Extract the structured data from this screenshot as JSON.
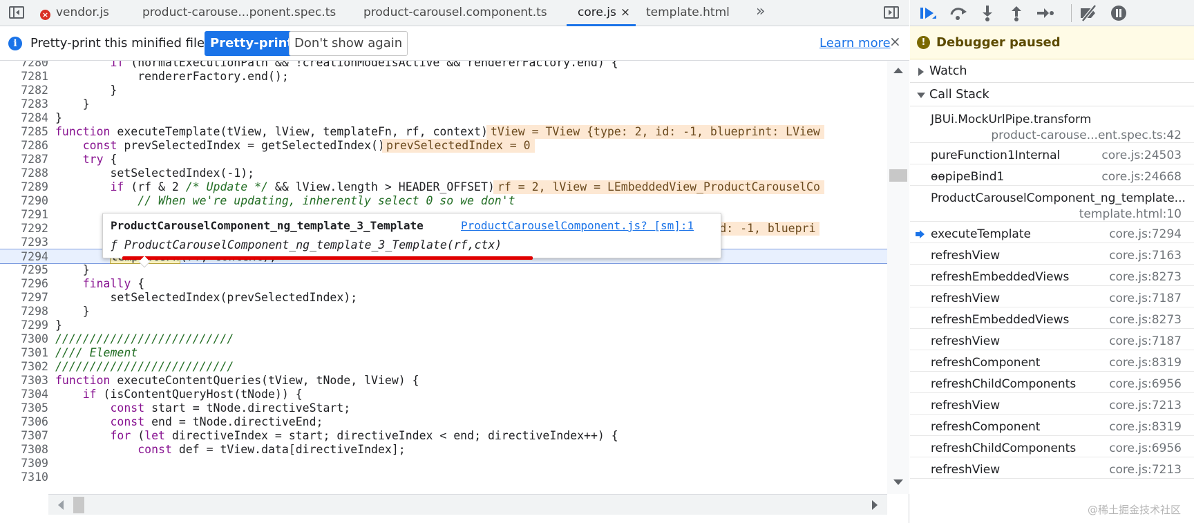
{
  "tabs": [
    {
      "label": "vendor.js",
      "has_error": true,
      "active": false
    },
    {
      "label": "product-carouse...ponent.spec.ts",
      "active": false
    },
    {
      "label": "product-carousel.component.ts",
      "active": false
    },
    {
      "label": "core.js",
      "active": true,
      "close": "×"
    },
    {
      "label": "template.html",
      "active": false
    }
  ],
  "tabs_more": "»",
  "infobar": {
    "icon": "i",
    "message": "Pretty-print this minified file?",
    "pretty_print_label": "Pretty-print",
    "dont_show_label": "Don't show again",
    "learn_more_label": "Learn more",
    "close": "×"
  },
  "code_lines": [
    {
      "n": "7280",
      "text": "        if (normalExecutionPath && !creationModeIsActive && rendererFactory.end) {"
    },
    {
      "n": "7281",
      "text": "            rendererFactory.end();"
    },
    {
      "n": "7282",
      "text": "        }"
    },
    {
      "n": "7283",
      "text": "    }"
    },
    {
      "n": "7284",
      "text": "}"
    },
    {
      "n": "7285",
      "text": "function executeTemplate(tView, lView, templateFn, rf, context) {",
      "inline": "tView = TView {type: 2, id: -1, blueprint: LView"
    },
    {
      "n": "7286",
      "text": "    const prevSelectedIndex = getSelectedIndex();",
      "inline": "prevSelectedIndex = 0"
    },
    {
      "n": "7287",
      "text": "    try {"
    },
    {
      "n": "7288",
      "text": "        setSelectedIndex(-1);"
    },
    {
      "n": "7289",
      "text": "        if (rf & 2 /* Update */ && lView.length > HEADER_OFFSET) {",
      "inline": "rf = 2, lView = LEmbeddedView_ProductCarouselCo"
    },
    {
      "n": "7290",
      "text": "            // When we're updating, inherently select 0 so we don't"
    },
    {
      "n": "7291",
      "text": ""
    },
    {
      "n": "7292",
      "text": "",
      "inline": "type: 2, id: -1, bluepri"
    },
    {
      "n": "7293",
      "text": "        }"
    },
    {
      "n": "7294",
      "text": "        templateFn(rf, context);",
      "current": true
    },
    {
      "n": "7295",
      "text": "    }"
    },
    {
      "n": "7296",
      "text": "    finally {"
    },
    {
      "n": "7297",
      "text": "        setSelectedIndex(prevSelectedIndex);"
    },
    {
      "n": "7298",
      "text": "    }"
    },
    {
      "n": "7299",
      "text": "}"
    },
    {
      "n": "7300",
      "text": "//////////////////////////"
    },
    {
      "n": "7301",
      "text": "//// Element"
    },
    {
      "n": "7302",
      "text": "//////////////////////////"
    },
    {
      "n": "7303",
      "text": "function executeContentQueries(tView, tNode, lView) {"
    },
    {
      "n": "7304",
      "text": "    if (isContentQueryHost(tNode)) {"
    },
    {
      "n": "7305",
      "text": "        const start = tNode.directiveStart;"
    },
    {
      "n": "7306",
      "text": "        const end = tNode.directiveEnd;"
    },
    {
      "n": "7307",
      "text": "        for (let directiveIndex = start; directiveIndex < end; directiveIndex++) {"
    },
    {
      "n": "7308",
      "text": "            const def = tView.data[directiveIndex];"
    },
    {
      "n": "7309",
      "text": ""
    },
    {
      "n": "7310",
      "text": ""
    }
  ],
  "popover": {
    "title": "ProductCarouselComponent_ng_template_3_Template",
    "link": "ProductCarouselComponent.js? [sm]:1",
    "signature": "ƒ ProductCarouselComponent_ng_template_3_Template(rf,ctx)"
  },
  "debugger": {
    "paused_icon": "!",
    "paused_label": "Debugger paused",
    "watch_label": "Watch",
    "callstack_label": "Call Stack",
    "frames": [
      {
        "name": "JBUi.MockUrlPipe.transform",
        "loc": "product-carouse...ent.spec.ts:42",
        "two_line": true
      },
      {
        "name": "pureFunction1Internal",
        "loc": "core.js:24503"
      },
      {
        "name": "ɵɵpipeBind1",
        "loc": "core.js:24668"
      },
      {
        "name": "ProductCarouselComponent_ng_template...",
        "loc": "template.html:10",
        "two_line": true
      },
      {
        "name": "executeTemplate",
        "loc": "core.js:7294",
        "current": true
      },
      {
        "name": "refreshView",
        "loc": "core.js:7163"
      },
      {
        "name": "refreshEmbeddedViews",
        "loc": "core.js:8273"
      },
      {
        "name": "refreshView",
        "loc": "core.js:7187"
      },
      {
        "name": "refreshEmbeddedViews",
        "loc": "core.js:8273"
      },
      {
        "name": "refreshView",
        "loc": "core.js:7187"
      },
      {
        "name": "refreshComponent",
        "loc": "core.js:8319"
      },
      {
        "name": "refreshChildComponents",
        "loc": "core.js:6956"
      },
      {
        "name": "refreshView",
        "loc": "core.js:7213"
      },
      {
        "name": "refreshComponent",
        "loc": "core.js:8319"
      },
      {
        "name": "refreshChildComponents",
        "loc": "core.js:6956"
      },
      {
        "name": "refreshView",
        "loc": "core.js:7213"
      }
    ]
  },
  "watermark": "@稀土掘金技术社区",
  "colors": {
    "accent": "#1a73e8",
    "current_line": "#e8f0fe",
    "inline_value_bg": "#fde8d3",
    "paused_bg": "#fffbe6",
    "annotation_red": "#e00000"
  }
}
